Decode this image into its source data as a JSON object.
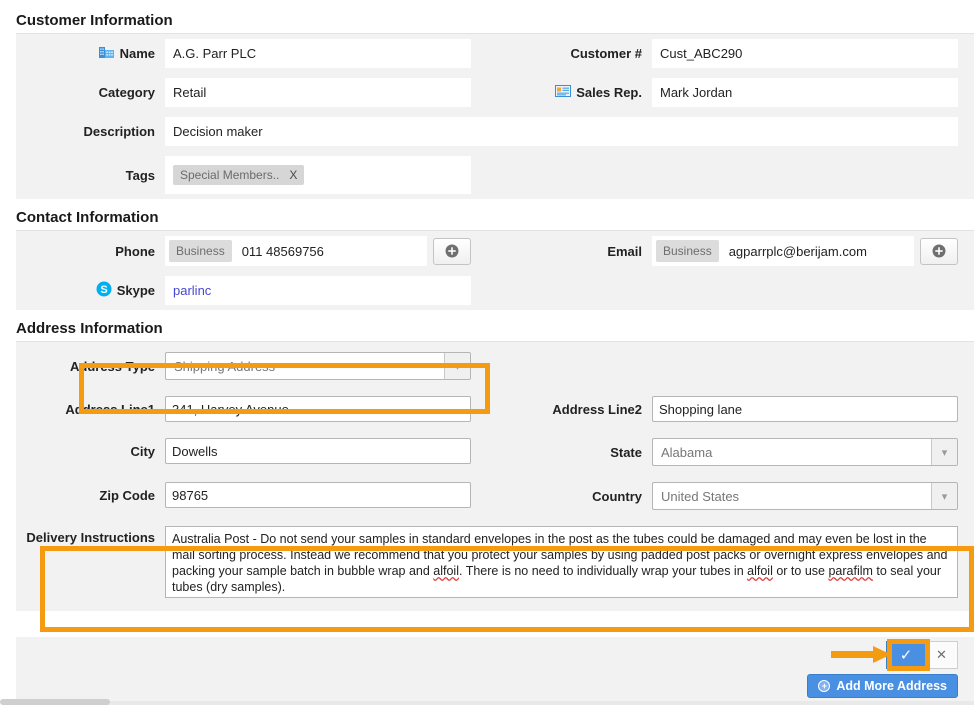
{
  "sections": {
    "customer": {
      "title": "Customer Information",
      "fields": {
        "name_label": "Name",
        "name_value": "A.G. Parr PLC",
        "customer_no_label": "Customer #",
        "customer_no_value": "Cust_ABC290",
        "category_label": "Category",
        "category_value": "Retail",
        "sales_rep_label": "Sales Rep.",
        "sales_rep_value": "Mark Jordan",
        "description_label": "Description",
        "description_value": "Decision maker",
        "tags_label": "Tags",
        "tag_chip": "Special Members..",
        "tag_chip_remove": "X"
      }
    },
    "contact": {
      "title": "Contact Information",
      "fields": {
        "phone_label": "Phone",
        "phone_type": "Business",
        "phone_value": "011 48569756",
        "phone_add": "+",
        "email_label": "Email",
        "email_type": "Business",
        "email_value": "agparrplc@berijam.com",
        "email_add": "+",
        "skype_label": "Skype",
        "skype_value": "parlinc"
      }
    },
    "address": {
      "title": "Address Information",
      "fields": {
        "address_type_label": "Address Type",
        "address_type_value": "Shipping Address",
        "address_line1_label": "Address Line1",
        "address_line1_value": "341, Harvey Avenue",
        "address_line2_label": "Address Line2",
        "address_line2_value": "Shopping lane",
        "city_label": "City",
        "city_value": "Dowells",
        "state_label": "State",
        "state_value": "Alabama",
        "zip_label": "Zip Code",
        "zip_value": "98765",
        "country_label": "Country",
        "country_value": "United States",
        "delivery_label": "Delivery Instructions",
        "delivery_part1": "Australia Post - Do not send your samples in standard envelopes in the post as the tubes could be damaged and may even be lost in the mail sorting process. Instead we recommend that you protect your samples by using padded post packs or overnight express envelopes and packing your sample batch in bubble wrap and ",
        "delivery_sp1": "alfoil",
        "delivery_part2": ". There is no need to individually wrap your tubes in ",
        "delivery_sp2": "alfoil",
        "delivery_part3": " or to use ",
        "delivery_sp3": "parafilm",
        "delivery_part4": " to seal your tubes (dry samples)."
      }
    }
  },
  "actions": {
    "confirm_label": "✓",
    "cancel_label": "✕",
    "add_more_address_label": "Add More Address",
    "add_more_plus": "+"
  },
  "colors": {
    "highlight": "#f59b12",
    "accent_blue": "#4a90e2",
    "link": "#4747d1",
    "panel_bg": "#f2f2f2"
  }
}
